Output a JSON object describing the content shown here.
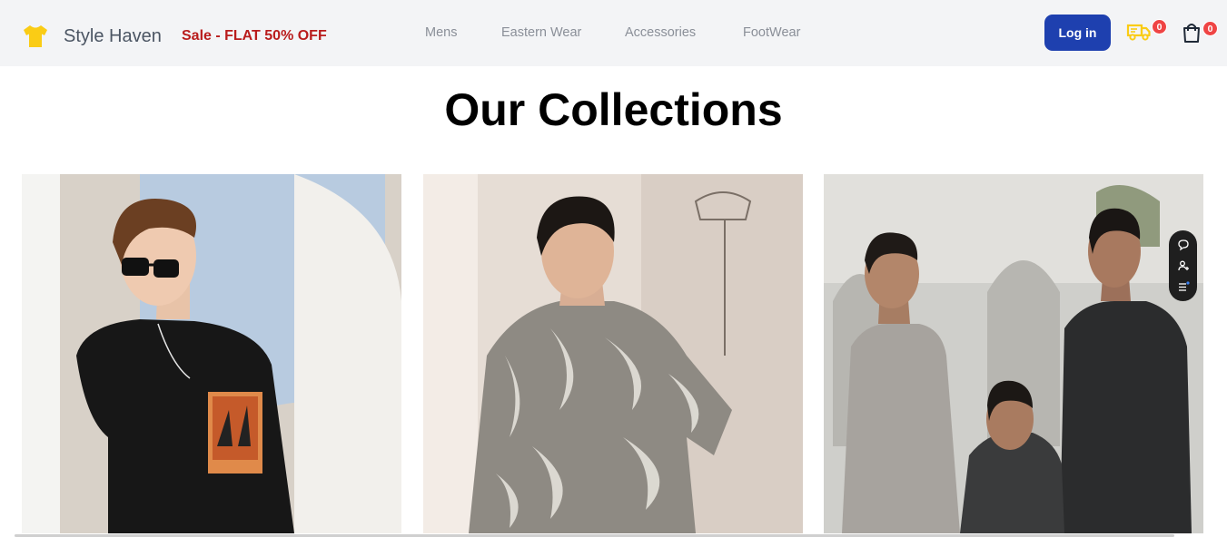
{
  "header": {
    "brand": "Style Haven",
    "sale_banner": "Sale - FLAT 50% OFF",
    "nav": [
      "Mens",
      "Eastern Wear",
      "Accessories",
      "FootWear"
    ],
    "login_label": "Log in",
    "delivery_count": "0",
    "cart_count": "0",
    "logo_icon": "tshirt-icon",
    "accent_color": "#1e40af",
    "sale_color": "#b91c1c"
  },
  "main": {
    "title": "Our Collections",
    "collections": [
      {
        "image": "model in black graphic t-shirt and sunglasses"
      },
      {
        "image": "model in grey palm-leaf print shirt"
      },
      {
        "image": "three models in eastern kurta wear"
      }
    ]
  },
  "floating_toolbar": {
    "icons": [
      "chat-icon",
      "add-user-icon",
      "list-icon"
    ]
  }
}
